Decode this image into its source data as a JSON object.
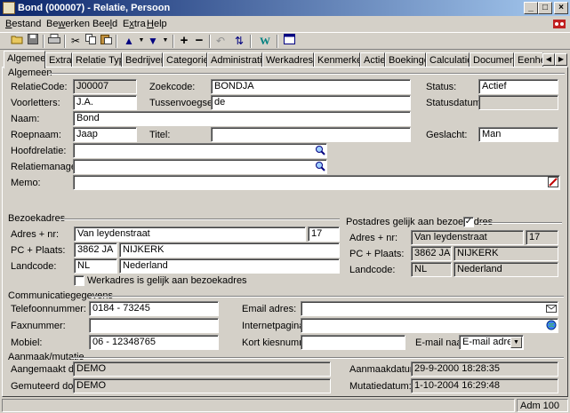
{
  "window": {
    "title": "Bond (000007) - Relatie, Persoon",
    "min": "_",
    "max": "□",
    "close": "×"
  },
  "menu": [
    {
      "label": "Bestand",
      "key": "B",
      "rest": "estand"
    },
    {
      "label": "Bewerken",
      "key": "w",
      "pre": "Be",
      "rest": "erken"
    },
    {
      "label": "Beeld",
      "key": "l",
      "pre": "Bee",
      "rest": "d"
    },
    {
      "label": "Extra",
      "key": "x",
      "pre": "E",
      "rest": "tra"
    },
    {
      "label": "Help",
      "key": "H",
      "rest": "elp"
    }
  ],
  "toolbar": {
    "icons": [
      "open-folder-icon",
      "save-icon",
      "print-icon",
      "cut-icon",
      "copy-icon",
      "paste-icon",
      "arrow-up-icon",
      "arrow-down-icon",
      "add-icon",
      "remove-icon",
      "undo-icon",
      "refresh-icon",
      "word-icon",
      "window-icon"
    ]
  },
  "tabs": [
    "Algemeen",
    "Extra",
    "Relatie Type",
    "Bedrijven",
    "Categorieen",
    "Administraties",
    "Werkadressen",
    "Kenmerken",
    "Acties",
    "Boekingen",
    "Calculaties",
    "Documenten",
    "Eenheid"
  ],
  "general": {
    "group": "Algemeen",
    "relatiecode_label": "RelatieCode:",
    "relatiecode": "J00007",
    "zoekcode_label": "Zoekcode:",
    "zoekcode": "BONDJA",
    "status_label": "Status:",
    "status": "Actief",
    "voorletters_label": "Voorletters:",
    "voorletters": "J.A.",
    "tussenvoegsels_label": "Tussenvoegsels:",
    "tussenvoegsels": "de",
    "statusdatum_label": "Statusdatum:",
    "statusdatum": "",
    "naam_label": "Naam:",
    "naam": "Bond",
    "roepnaam_label": "Roepnaam:",
    "roepnaam": "Jaap",
    "titel_label": "Titel:",
    "titel": "",
    "geslacht_label": "Geslacht:",
    "geslacht": "Man",
    "hoofdrelatie_label": "Hoofdrelatie:",
    "hoofdrelatie": "",
    "relatiemanager_label": "Relatiemanager:",
    "relatiemanager": "",
    "memo_label": "Memo:",
    "memo": ""
  },
  "bezoek": {
    "group": "Bezoekadres",
    "adres_label": "Adres + nr:",
    "straat": "Van leydenstraat",
    "nr": "17",
    "pc_label": "PC + Plaats:",
    "pc": "3862 JA",
    "plaats": "NIJKERK",
    "land_label": "Landcode:",
    "landcode": "NL",
    "land": "Nederland",
    "werkadres_label": "Werkadres is gelijk aan bezoekadres"
  },
  "post": {
    "group": "Postadres gelijk aan bezoekadres",
    "checked": "✓",
    "adres_label": "Adres + nr:",
    "straat": "Van leydenstraat",
    "nr": "17",
    "pc_label": "PC + Plaats:",
    "pc": "3862 JA",
    "plaats": "NIJKERK",
    "land_label": "Landcode:",
    "landcode": "NL",
    "land": "Nederland"
  },
  "comm": {
    "group": "Communicatiegegevens",
    "tel_label": "Telefoonnummer:",
    "tel": "0184 - 73245",
    "fax_label": "Faxnummer:",
    "fax": "",
    "mobiel_label": "Mobiel:",
    "mobiel": "06 - 12348765",
    "email_label": "Email adres:",
    "email": "",
    "internet_label": "Internetpagina:",
    "internet": "",
    "kort_label": "Kort kiesnummer:",
    "kort": "",
    "emailnaar_label": "E-mail naar:",
    "emailnaar": "E-mail adres"
  },
  "mutatie": {
    "group": "Aanmaak/mutatie",
    "aangemaakt_label": "Aangemaakt door:",
    "aangemaakt": "DEMO",
    "gemuteerd_label": "Gemuteerd door:",
    "gemuteerd": "DEMO",
    "aanmaakdatum_label": "Aanmaakdatum:",
    "aanmaakdatum": "29-9-2000 18:28:35",
    "mutatiedatum_label": "Mutatiedatum:",
    "mutatiedatum": "1-10-2004 16:29:48"
  },
  "status": {
    "user": "Adm 100"
  }
}
